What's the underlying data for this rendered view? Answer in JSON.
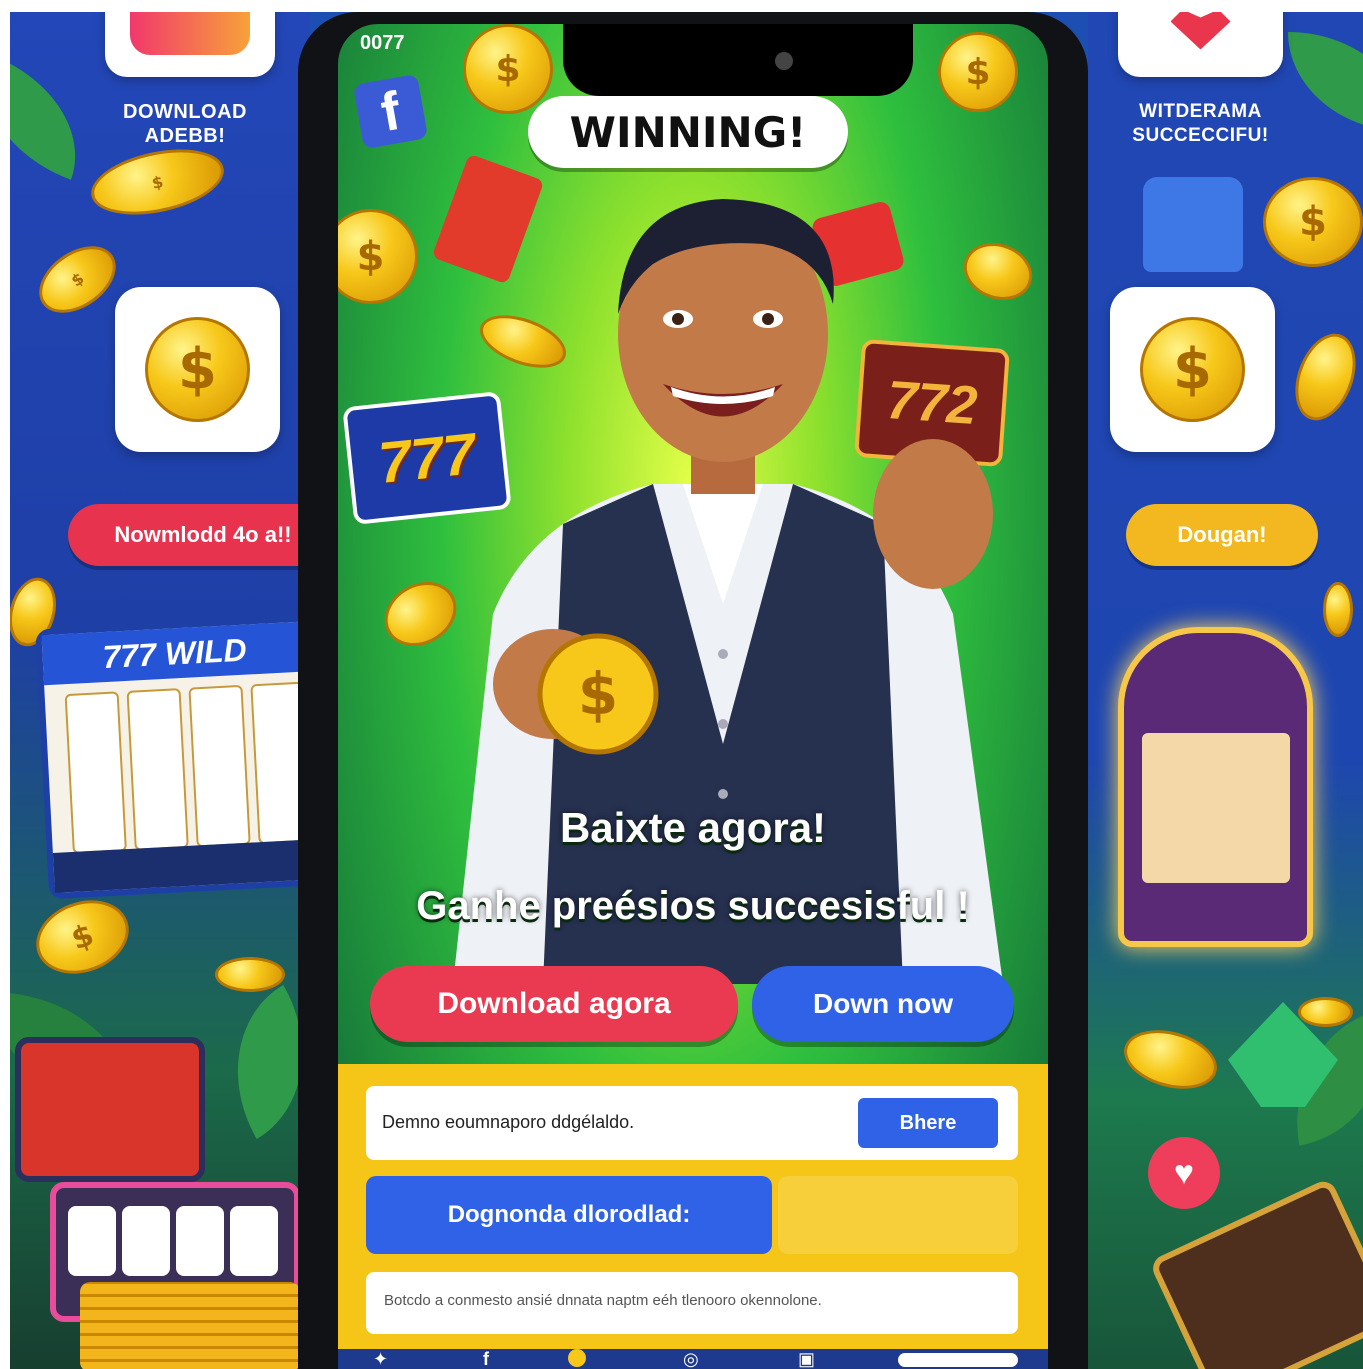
{
  "left_panel": {
    "caption": "DOWNLOAD\nADEBB!",
    "cta_label": "Nowmlodd 4o a!!",
    "slot_banner": "777 WILD",
    "colors": {
      "cta": "#e8334f",
      "panel": "#2347b8"
    }
  },
  "right_panel": {
    "caption": "WITDERAMA\nSUCCECCIFU!",
    "cta_label": "Dougan!",
    "colors": {
      "cta": "#f3b81f"
    }
  },
  "phone": {
    "status": "0077",
    "bubble_text": "WINNING!",
    "badge_left": "777",
    "badge_right": "772",
    "headline1": "Baixte agora!",
    "headline2": "Ganhe preésios succesisful !",
    "btn_primary": "Download agora",
    "btn_secondary": "Down now",
    "field1_text": "Demno eoumnaporo ddgélaldo.",
    "share_label": "Bhere",
    "field2_label": "Dognonda dlorodlad:",
    "footer_text": "Botcdo a conmesto ansié  dnnata naptm eéh tlenooro okennolone.",
    "colors": {
      "red": "#ea3a52",
      "blue": "#2f62e6",
      "yellow": "#f5c518"
    },
    "icons": [
      "facebook-icon",
      "heart-icon",
      "coin-icon",
      "instagram-icon",
      "shield-icon"
    ]
  }
}
